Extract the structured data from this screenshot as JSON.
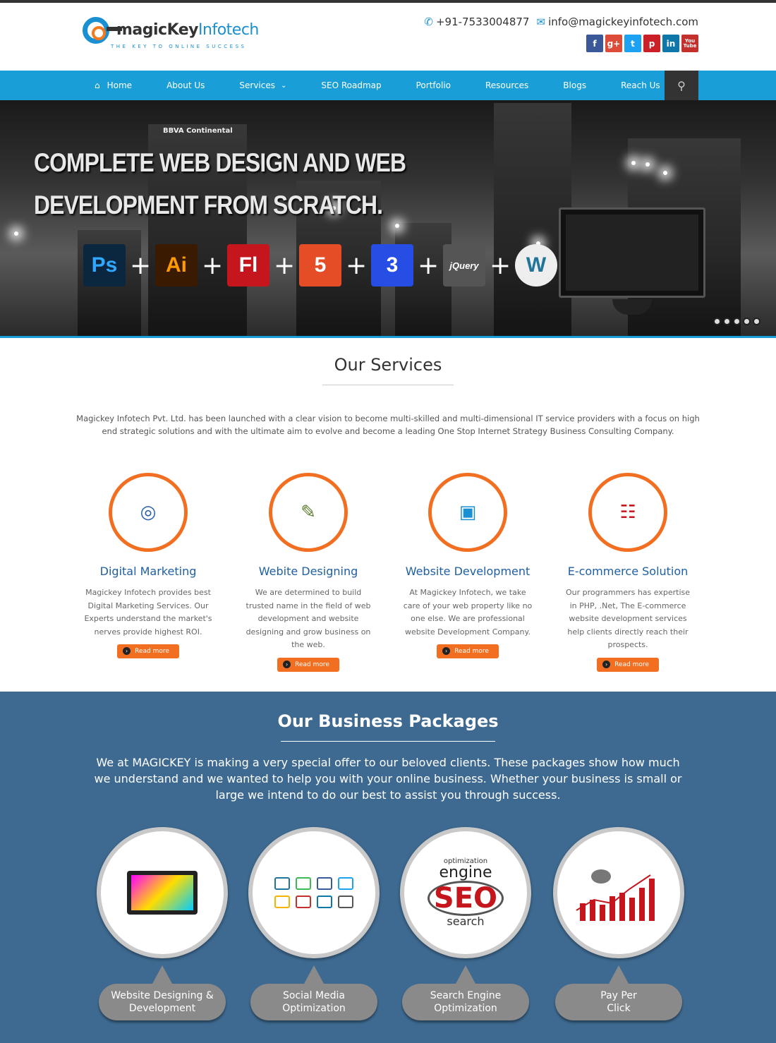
{
  "brand": {
    "name_part1": "magicKey",
    "name_part2": "Infotech",
    "tagline": "THE KEY TO ONLINE SUCCESS"
  },
  "contact": {
    "phone": "+91-7533004877",
    "email": "info@magickeyinfotech.com"
  },
  "social": [
    {
      "icon": "facebook-icon",
      "glyph": "f",
      "color": "#3b5998"
    },
    {
      "icon": "google-plus-icon",
      "glyph": "g+",
      "color": "#dd4b39"
    },
    {
      "icon": "twitter-icon",
      "glyph": "t",
      "color": "#1da1f2"
    },
    {
      "icon": "pinterest-icon",
      "glyph": "p",
      "color": "#cb2027"
    },
    {
      "icon": "linkedin-icon",
      "glyph": "in",
      "color": "#0e76a8"
    },
    {
      "icon": "youtube-icon",
      "glyph": "You Tube",
      "color": "#c4302b"
    }
  ],
  "nav": {
    "items": [
      {
        "label": "Home"
      },
      {
        "label": "About Us"
      },
      {
        "label": "Services"
      },
      {
        "label": "SEO Roadmap"
      },
      {
        "label": "Portfolio"
      },
      {
        "label": "Resources"
      },
      {
        "label": "Blogs"
      },
      {
        "label": "Reach Us"
      }
    ]
  },
  "hero": {
    "sign": "BBVA Continental",
    "line1": "COMPLETE WEB DESIGN AND WEB",
    "line2": "DEVELOPMENT FROM SCRATCH.",
    "tools": [
      {
        "label": "Ps",
        "color": "#31a8ff",
        "bg": "#0b2740"
      },
      {
        "label": "Ai",
        "color": "#ff9a00",
        "bg": "#3a1a00"
      },
      {
        "label": "Fl",
        "color": "#fff",
        "bg": "#c4161c"
      },
      {
        "label": "5",
        "color": "#fff",
        "bg": "#e44d26"
      },
      {
        "label": "3",
        "color": "#fff",
        "bg": "#264de4"
      },
      {
        "label": "jQuery",
        "color": "#fff",
        "bg": "#555"
      },
      {
        "label": "W",
        "color": "#21759b",
        "bg": "#eee"
      }
    ],
    "slide_count": 5
  },
  "services": {
    "title": "Our Services",
    "intro": "Magickey Infotech Pvt. Ltd. has been launched with a clear vision to become multi-skilled and multi-dimensional IT service providers with a focus on high end strategic solutions and with the ultimate aim to evolve and become a leading One Stop Internet Strategy Business Consulting Company.",
    "items": [
      {
        "title": "Digital Marketing",
        "text": "Magickey Infotech provides best Digital Marketing Services. Our Experts understand the market's nerves provide highest ROI.",
        "button": "Read more",
        "icon": "globe-gear-icon"
      },
      {
        "title": "Webite Designing",
        "text": "We are determined to build trusted name in the field of web development and website designing and grow business on the web.",
        "button": "Read more",
        "icon": "paint-brushes-icon"
      },
      {
        "title": "Website Development",
        "text": "At Magickey Infotech, we take care of your web property like no one else. We are professional website Development Company.",
        "button": "Read more",
        "icon": "monitor-globe-icon"
      },
      {
        "title": "E-commerce Solution",
        "text": "Our programmers has expertise in PHP, .Net, The E-commerce website development services help clients directly reach their prospects.",
        "button": "Read more",
        "icon": "shopping-cart-icon"
      }
    ]
  },
  "packages": {
    "title": "Our Business Packages",
    "intro": "We at MAGICKEY is making a very special offer to our beloved clients. These packages show how much we understand and we wanted to help you with your online business. Whether your business is small or large we intend to do our best to assist you through success.",
    "items": [
      {
        "label_line1": "Website Designing &",
        "label_line2": "Development",
        "icon": "devices-palette-icon"
      },
      {
        "label_line1": "Social Media",
        "label_line2": "Optimization",
        "icon": "social-network-icon"
      },
      {
        "label_line1": "Search Engine",
        "label_line2": "Optimization",
        "icon": "seo-magnifier-icon"
      },
      {
        "label_line1": "Pay Per",
        "label_line2": "Click",
        "icon": "mouse-chart-icon"
      }
    ],
    "seo_words": {
      "big": "SEO",
      "w1": "engine",
      "w2": "search",
      "w3": "optimization"
    }
  }
}
